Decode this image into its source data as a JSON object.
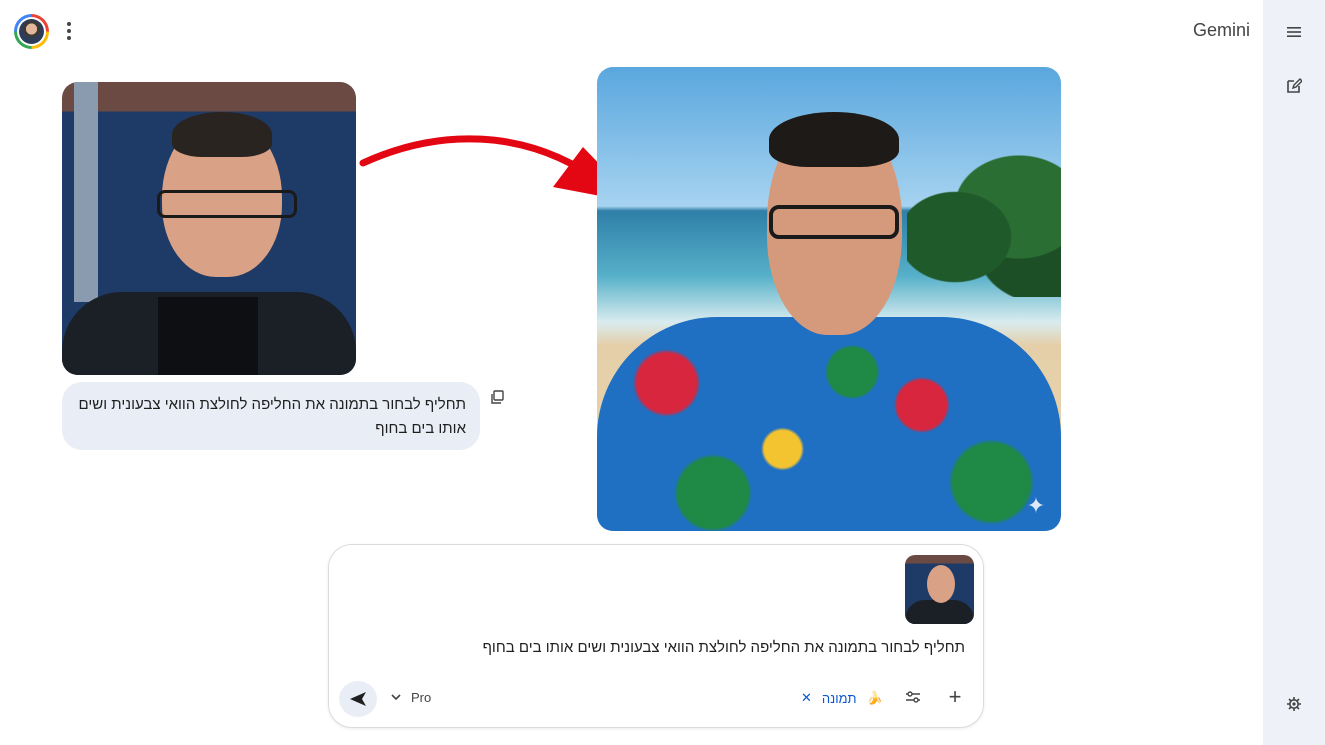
{
  "header": {
    "brand": "Gemini"
  },
  "icons": {
    "menu": "hamburger-icon",
    "new_chat": "edit-icon",
    "settings": "gear-icon",
    "more": "more-vert-icon",
    "copy": "copy-icon",
    "send": "send-icon",
    "tools": "tune-icon",
    "add": "plus-icon",
    "remove": "close-icon",
    "banana": "banana-icon",
    "sparkle": "sparkle-icon"
  },
  "conversation": {
    "user_message": "תחליף לבחור בתמונה את החליפה לחולצת הוואי צבעונית ושים אותו בים בחוף"
  },
  "composer": {
    "prompt_text": "תחליף לבחור בתמונה את החליפה לחולצת הוואי צבעונית ושים אותו בים בחוף",
    "model_label": "Pro",
    "image_tool_chip": "תמונה",
    "banana_glyph": "🍌",
    "remove_glyph": "✕",
    "plus_glyph": "+"
  },
  "colors": {
    "accent": "#0b57d0",
    "rail": "#eef1f8",
    "bubble": "#e9eef6",
    "arrow": "#e30613"
  }
}
